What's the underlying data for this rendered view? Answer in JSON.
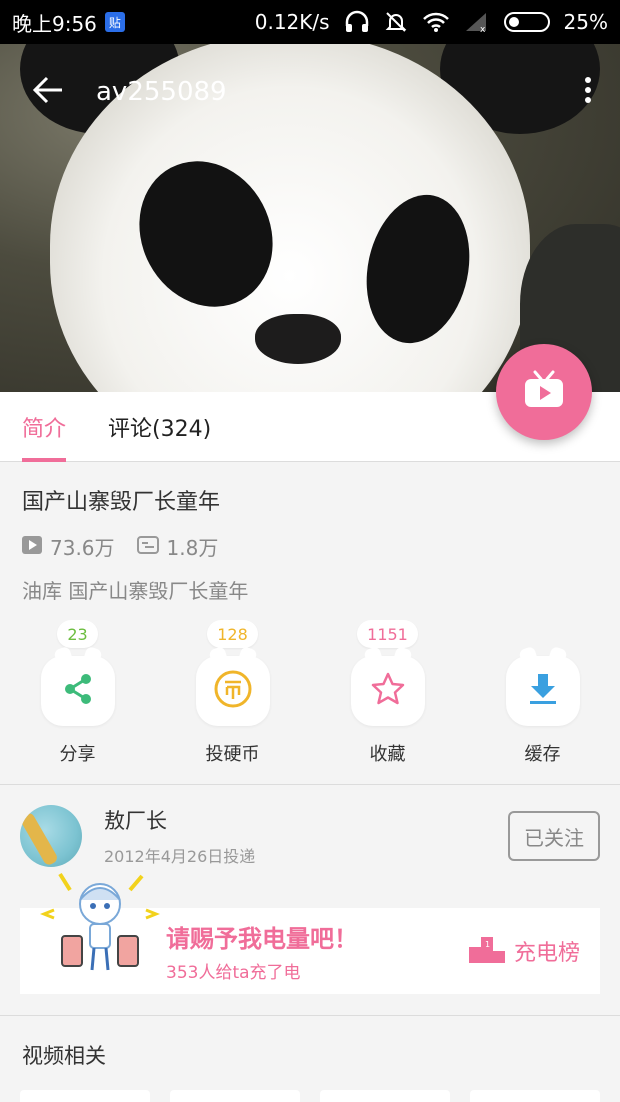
{
  "status_bar": {
    "time": "晚上9:56",
    "badge": "贴",
    "speed": "0.12K/s",
    "battery": "25%"
  },
  "header": {
    "title": "av255089",
    "back_icon": "arrow-left-icon",
    "more_icon": "more-vertical-icon"
  },
  "fab": {
    "icon": "tv-icon"
  },
  "tabs": [
    {
      "label": "简介",
      "active": true
    },
    {
      "label": "评论(324)",
      "active": false
    }
  ],
  "video": {
    "title": "国产山寨毁厂长童年",
    "plays": "73.6万",
    "danmaku": "1.8万",
    "description": "油库 国产山寨毁厂长童年"
  },
  "actions": [
    {
      "label": "分享",
      "count": "23",
      "icon": "share-icon",
      "count_color": "#6cbd3f"
    },
    {
      "label": "投硬币",
      "count": "128",
      "icon": "coin-icon",
      "count_color": "#f0b52a"
    },
    {
      "label": "收藏",
      "count": "1151",
      "icon": "star-icon",
      "count_color": "#f06d99"
    },
    {
      "label": "缓存",
      "count": "",
      "icon": "download-icon",
      "count_color": "#3aa0e0"
    }
  ],
  "uploader": {
    "name": "敖厂长",
    "date": "2012年4月26日投递",
    "follow_label": "已关注"
  },
  "charge": {
    "title": "请赐予我电量吧！",
    "subtitle": "353人给ta充了电",
    "rank_label": "充电榜"
  },
  "related": {
    "title": "视频相关"
  },
  "colors": {
    "accent": "#f06d99"
  }
}
